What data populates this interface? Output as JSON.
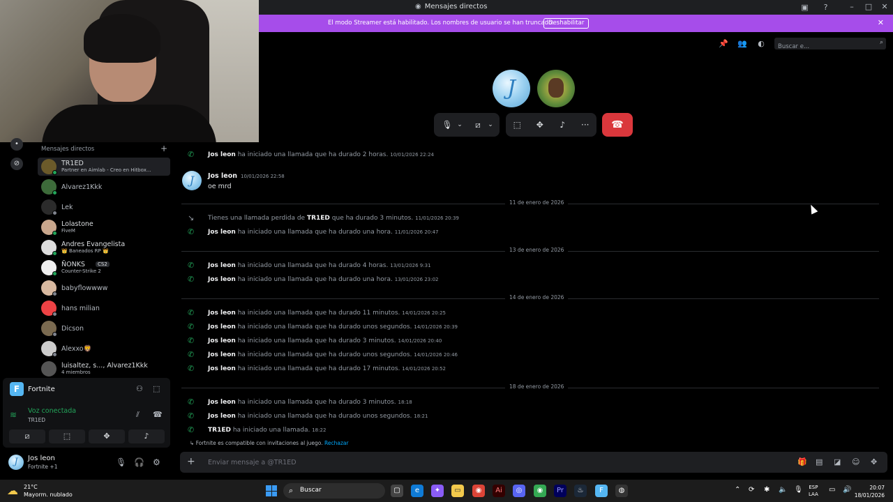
{
  "window": {
    "title": "Mensajes directos",
    "icons": [
      "inbox-icon",
      "help-icon",
      "minimize-icon",
      "maximize-icon",
      "close-icon"
    ]
  },
  "banner": {
    "text": "El modo Streamer está habilitado. Los nombres de usuario se han truncado.",
    "button": "Deshabilitar",
    "color": "#a64dea"
  },
  "call": {
    "search_placeholder": "Buscar e...",
    "controls": [
      "mic-icon",
      "mic-options-icon",
      "camera-off-icon",
      "camera-options-icon",
      "screenshare-icon",
      "activities-icon",
      "soundboard-icon",
      "more-icon"
    ],
    "hangup_color": "#da373c"
  },
  "sidebar": {
    "header": "Mensajes directos",
    "dms": [
      {
        "name": "TR1ED",
        "sub": "Partner en Aimlab - Creo en Hitbox...",
        "status": "#23a55a",
        "avatar_color": "#6b5a2a",
        "active": true
      },
      {
        "name": "Alvarez1Kkk",
        "sub": "",
        "status": "#23a55a",
        "avatar_color": "#3d6b3a"
      },
      {
        "name": "Lek",
        "sub": "",
        "status": "#80848e",
        "avatar_color": "#2b2b2b"
      },
      {
        "name": "Lolastone",
        "sub": "FiveM",
        "status": "#23a55a",
        "avatar_color": "#c9a78d"
      },
      {
        "name": "Andres Evangelista",
        "sub": "👑 Baneados RP 👑",
        "status": "#23a55a",
        "avatar_color": "#dddddd"
      },
      {
        "name": "ÑONKS",
        "badge": "CS2",
        "sub": "Counter-Strike 2",
        "status": "#23a55a",
        "avatar_color": "#eeeeee"
      },
      {
        "name": "babyflowwww",
        "sub": "",
        "status": "#80848e",
        "avatar_color": "#d8b9a0"
      },
      {
        "name": "hans milian",
        "sub": "",
        "status": "#80848e",
        "avatar_color": "#ed4245"
      },
      {
        "name": "Dicson",
        "sub": "",
        "status": "#80848e",
        "avatar_color": "#7a6a50"
      },
      {
        "name": "Alexxo🦁",
        "sub": "",
        "status": "#80848e",
        "avatar_color": "#cccccc"
      },
      {
        "name": "luisaltez, s..., Alvarez1Kkk",
        "sub": "4 miembros",
        "status": "",
        "avatar_color": "#555555"
      }
    ]
  },
  "activity": {
    "game": "Fortnite",
    "voice_title": "Voz conectada",
    "voice_sub": "TR1ED"
  },
  "user": {
    "name": "Jos leon",
    "sub": "Fortnite +1"
  },
  "chat": {
    "entries": [
      {
        "kind": "call",
        "author": "Jos leon",
        "text": "ha iniciado una llamada que ha durado 2 horas.",
        "ts": "10/01/2026 22:24"
      },
      {
        "kind": "message",
        "author": "Jos leon",
        "ts": "10/01/2026 22:58",
        "text": "oe mrd"
      },
      {
        "kind": "divider",
        "text": "11 de enero de 2026"
      },
      {
        "kind": "missed",
        "pre": "Tienes una llamada perdida de",
        "author": "TR1ED",
        "text": "que ha durado 3 minutos.",
        "ts": "11/01/2026 20:39"
      },
      {
        "kind": "call",
        "author": "Jos leon",
        "text": "ha iniciado una llamada que ha durado una hora.",
        "ts": "11/01/2026 20:47"
      },
      {
        "kind": "divider",
        "text": "13 de enero de 2026"
      },
      {
        "kind": "call",
        "author": "Jos leon",
        "text": "ha iniciado una llamada que ha durado 4 horas.",
        "ts": "13/01/2026 9:31"
      },
      {
        "kind": "call",
        "author": "Jos leon",
        "text": "ha iniciado una llamada que ha durado una hora.",
        "ts": "13/01/2026 23:02"
      },
      {
        "kind": "divider",
        "text": "14 de enero de 2026"
      },
      {
        "kind": "call",
        "author": "Jos leon",
        "text": "ha iniciado una llamada que ha durado 11 minutos.",
        "ts": "14/01/2026 20:25"
      },
      {
        "kind": "call",
        "author": "Jos leon",
        "text": "ha iniciado una llamada que ha durado unos segundos.",
        "ts": "14/01/2026 20:39"
      },
      {
        "kind": "call",
        "author": "Jos leon",
        "text": "ha iniciado una llamada que ha durado 3 minutos.",
        "ts": "14/01/2026 20:40"
      },
      {
        "kind": "call",
        "author": "Jos leon",
        "text": "ha iniciado una llamada que ha durado unos segundos.",
        "ts": "14/01/2026 20:46"
      },
      {
        "kind": "call",
        "author": "Jos leon",
        "text": "ha iniciado una llamada que ha durado 17 minutos.",
        "ts": "14/01/2026 20:52"
      },
      {
        "kind": "divider",
        "text": "18 de enero de 2026"
      },
      {
        "kind": "call",
        "author": "Jos leon",
        "text": "ha iniciado una llamada que ha durado 3 minutos.",
        "ts": "18:18"
      },
      {
        "kind": "call",
        "author": "Jos leon",
        "text": "ha iniciado una llamada que ha durado unos segundos.",
        "ts": "18:21"
      },
      {
        "kind": "call",
        "author": "TR1ED",
        "text": "ha iniciado una llamada.",
        "ts": "18:22"
      }
    ],
    "game_notice": "Fortnite es compatible con invitaciones al juego.",
    "game_notice_link": "Rechazar"
  },
  "composer": {
    "placeholder": "Enviar mensaje a @TR1ED"
  },
  "taskbar": {
    "temp": "21°C",
    "weather": "Mayorm. nublado",
    "search": "Buscar",
    "lang_top": "ESP",
    "lang_bottom": "LAA",
    "time": "20:07",
    "date": "18/01/2026"
  }
}
